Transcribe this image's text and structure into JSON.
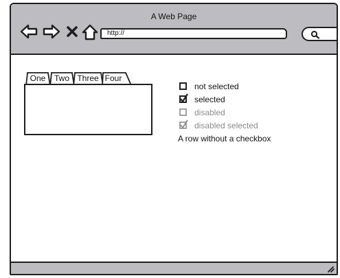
{
  "window": {
    "title": "A Web Page"
  },
  "toolbar": {
    "back_icon": "left-arrow-icon",
    "forward_icon": "right-arrow-icon",
    "stop_icon": "x-icon",
    "home_icon": "home-icon",
    "url": "http://",
    "search_icon": "magnifier-icon"
  },
  "tabs": [
    {
      "label": "One"
    },
    {
      "label": "Two"
    },
    {
      "label": "Three"
    },
    {
      "label": "Four"
    }
  ],
  "checkboxes": [
    {
      "label": "not selected",
      "checked": false,
      "disabled": false
    },
    {
      "label": "selected",
      "checked": true,
      "disabled": false
    },
    {
      "label": "disabled",
      "checked": false,
      "disabled": true
    },
    {
      "label": "disabled selected",
      "checked": true,
      "disabled": true
    },
    {
      "label": "A row without a checkbox",
      "checkbox": false
    }
  ],
  "colors": {
    "chrome": "#bdbdc1",
    "stroke": "#1e1e1e",
    "disabled": "#8a8a8a"
  }
}
